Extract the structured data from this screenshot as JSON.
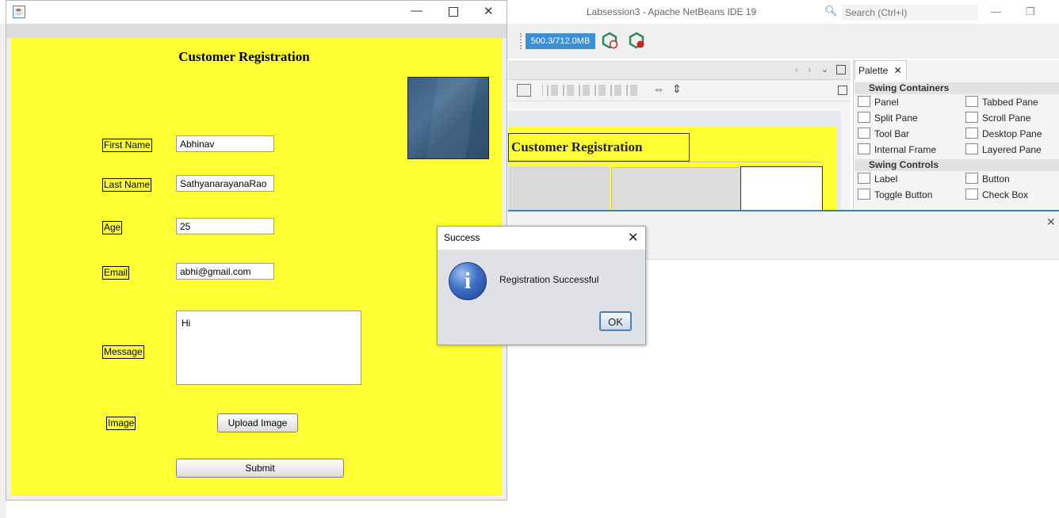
{
  "ide": {
    "title": "Labsession3 - Apache NetBeans IDE 19",
    "search_placeholder": "Search (Ctrl+I)",
    "memory": "500.3/712.0MB",
    "palette": {
      "tab_label": "Palette",
      "sections": [
        {
          "name": "Swing Containers",
          "items": [
            "Panel",
            "Tabbed Pane",
            "Split Pane",
            "Scroll Pane",
            "Tool Bar",
            "Desktop Pane",
            "Internal Frame",
            "Layered Pane"
          ]
        },
        {
          "name": "Swing Controls",
          "items": [
            "Label",
            "Button",
            "Toggle Button",
            "Check Box"
          ]
        }
      ]
    },
    "design_preview_title": "Customer Registration"
  },
  "form": {
    "title": "Customer Registration",
    "fields": {
      "first_name": {
        "label": "First Name",
        "value": "Abhinav"
      },
      "last_name": {
        "label": "Last Name",
        "value": "SathyanarayanaRao"
      },
      "age": {
        "label": "Age",
        "value": "25"
      },
      "email": {
        "label": "Email",
        "value": "abhi@gmail.com"
      },
      "message": {
        "label": "Message",
        "value": "Hi"
      }
    },
    "image_label": "Image",
    "upload_button": "Upload Image",
    "submit_button": "Submit"
  },
  "dialog": {
    "title": "Success",
    "message": "Registration Successful",
    "ok_button": "OK",
    "icon": "info-icon"
  },
  "colors": {
    "panel_yellow": "#ffff33",
    "memory_bar": "#3b8fd6",
    "dialog_bg": "#dfe1e6"
  }
}
